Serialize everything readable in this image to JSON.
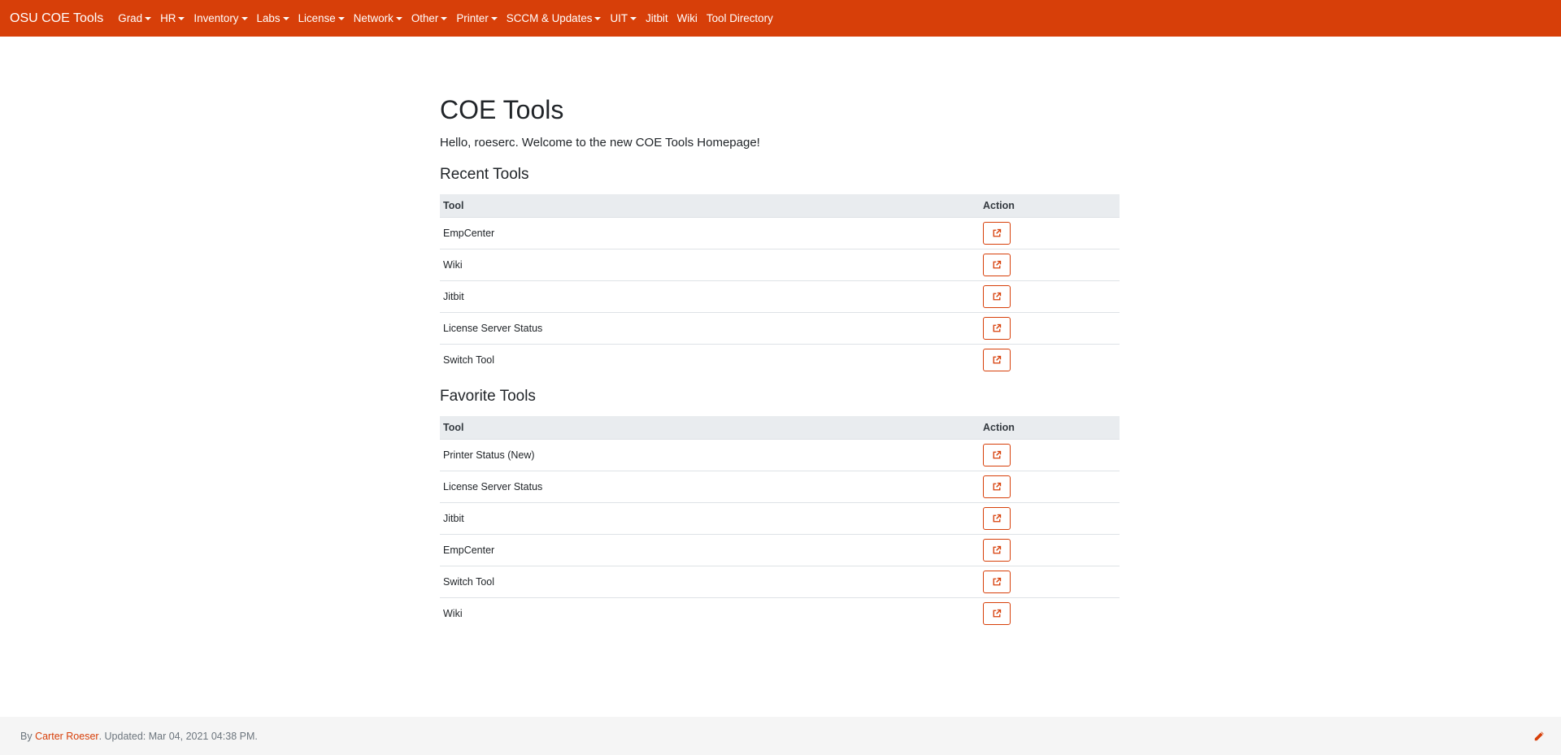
{
  "navbar": {
    "brand": "OSU COE Tools",
    "menus": [
      {
        "label": "Grad",
        "dropdown": true
      },
      {
        "label": "HR",
        "dropdown": true
      },
      {
        "label": "Inventory",
        "dropdown": true
      },
      {
        "label": "Labs",
        "dropdown": true
      },
      {
        "label": "License",
        "dropdown": true
      },
      {
        "label": "Network",
        "dropdown": true
      },
      {
        "label": "Other",
        "dropdown": true
      },
      {
        "label": "Printer",
        "dropdown": true
      },
      {
        "label": "SCCM & Updates",
        "dropdown": true
      },
      {
        "label": "UIT",
        "dropdown": true
      },
      {
        "label": "Jitbit",
        "dropdown": false
      },
      {
        "label": "Wiki",
        "dropdown": false
      },
      {
        "label": "Tool Directory",
        "dropdown": false
      }
    ]
  },
  "main": {
    "title": "COE Tools",
    "greeting": {
      "prefix": "Hello, ",
      "user": "roeserc",
      "suffix": ". Welcome to the new COE Tools Homepage!"
    },
    "recent": {
      "heading": "Recent Tools",
      "columns": [
        "Tool",
        "Action"
      ],
      "rows": [
        "EmpCenter",
        "Wiki",
        "Jitbit",
        "License Server Status",
        "Switch Tool"
      ]
    },
    "favorites": {
      "heading": "Favorite Tools",
      "columns": [
        "Tool",
        "Action"
      ],
      "rows": [
        "Printer Status (New)",
        "License Server Status",
        "Jitbit",
        "EmpCenter",
        "Switch Tool",
        "Wiki"
      ]
    }
  },
  "footer": {
    "prefix": "By ",
    "author": "Carter Roeser",
    "suffix": ". Updated: Mar 04, 2021 04:38 PM."
  },
  "colors": {
    "brand": "#d73f09",
    "header_row": "#e9ecef",
    "footer_bg": "#f5f5f5"
  },
  "icons": {
    "action": "external-link-icon",
    "footer_edit": "pencil-icon"
  }
}
